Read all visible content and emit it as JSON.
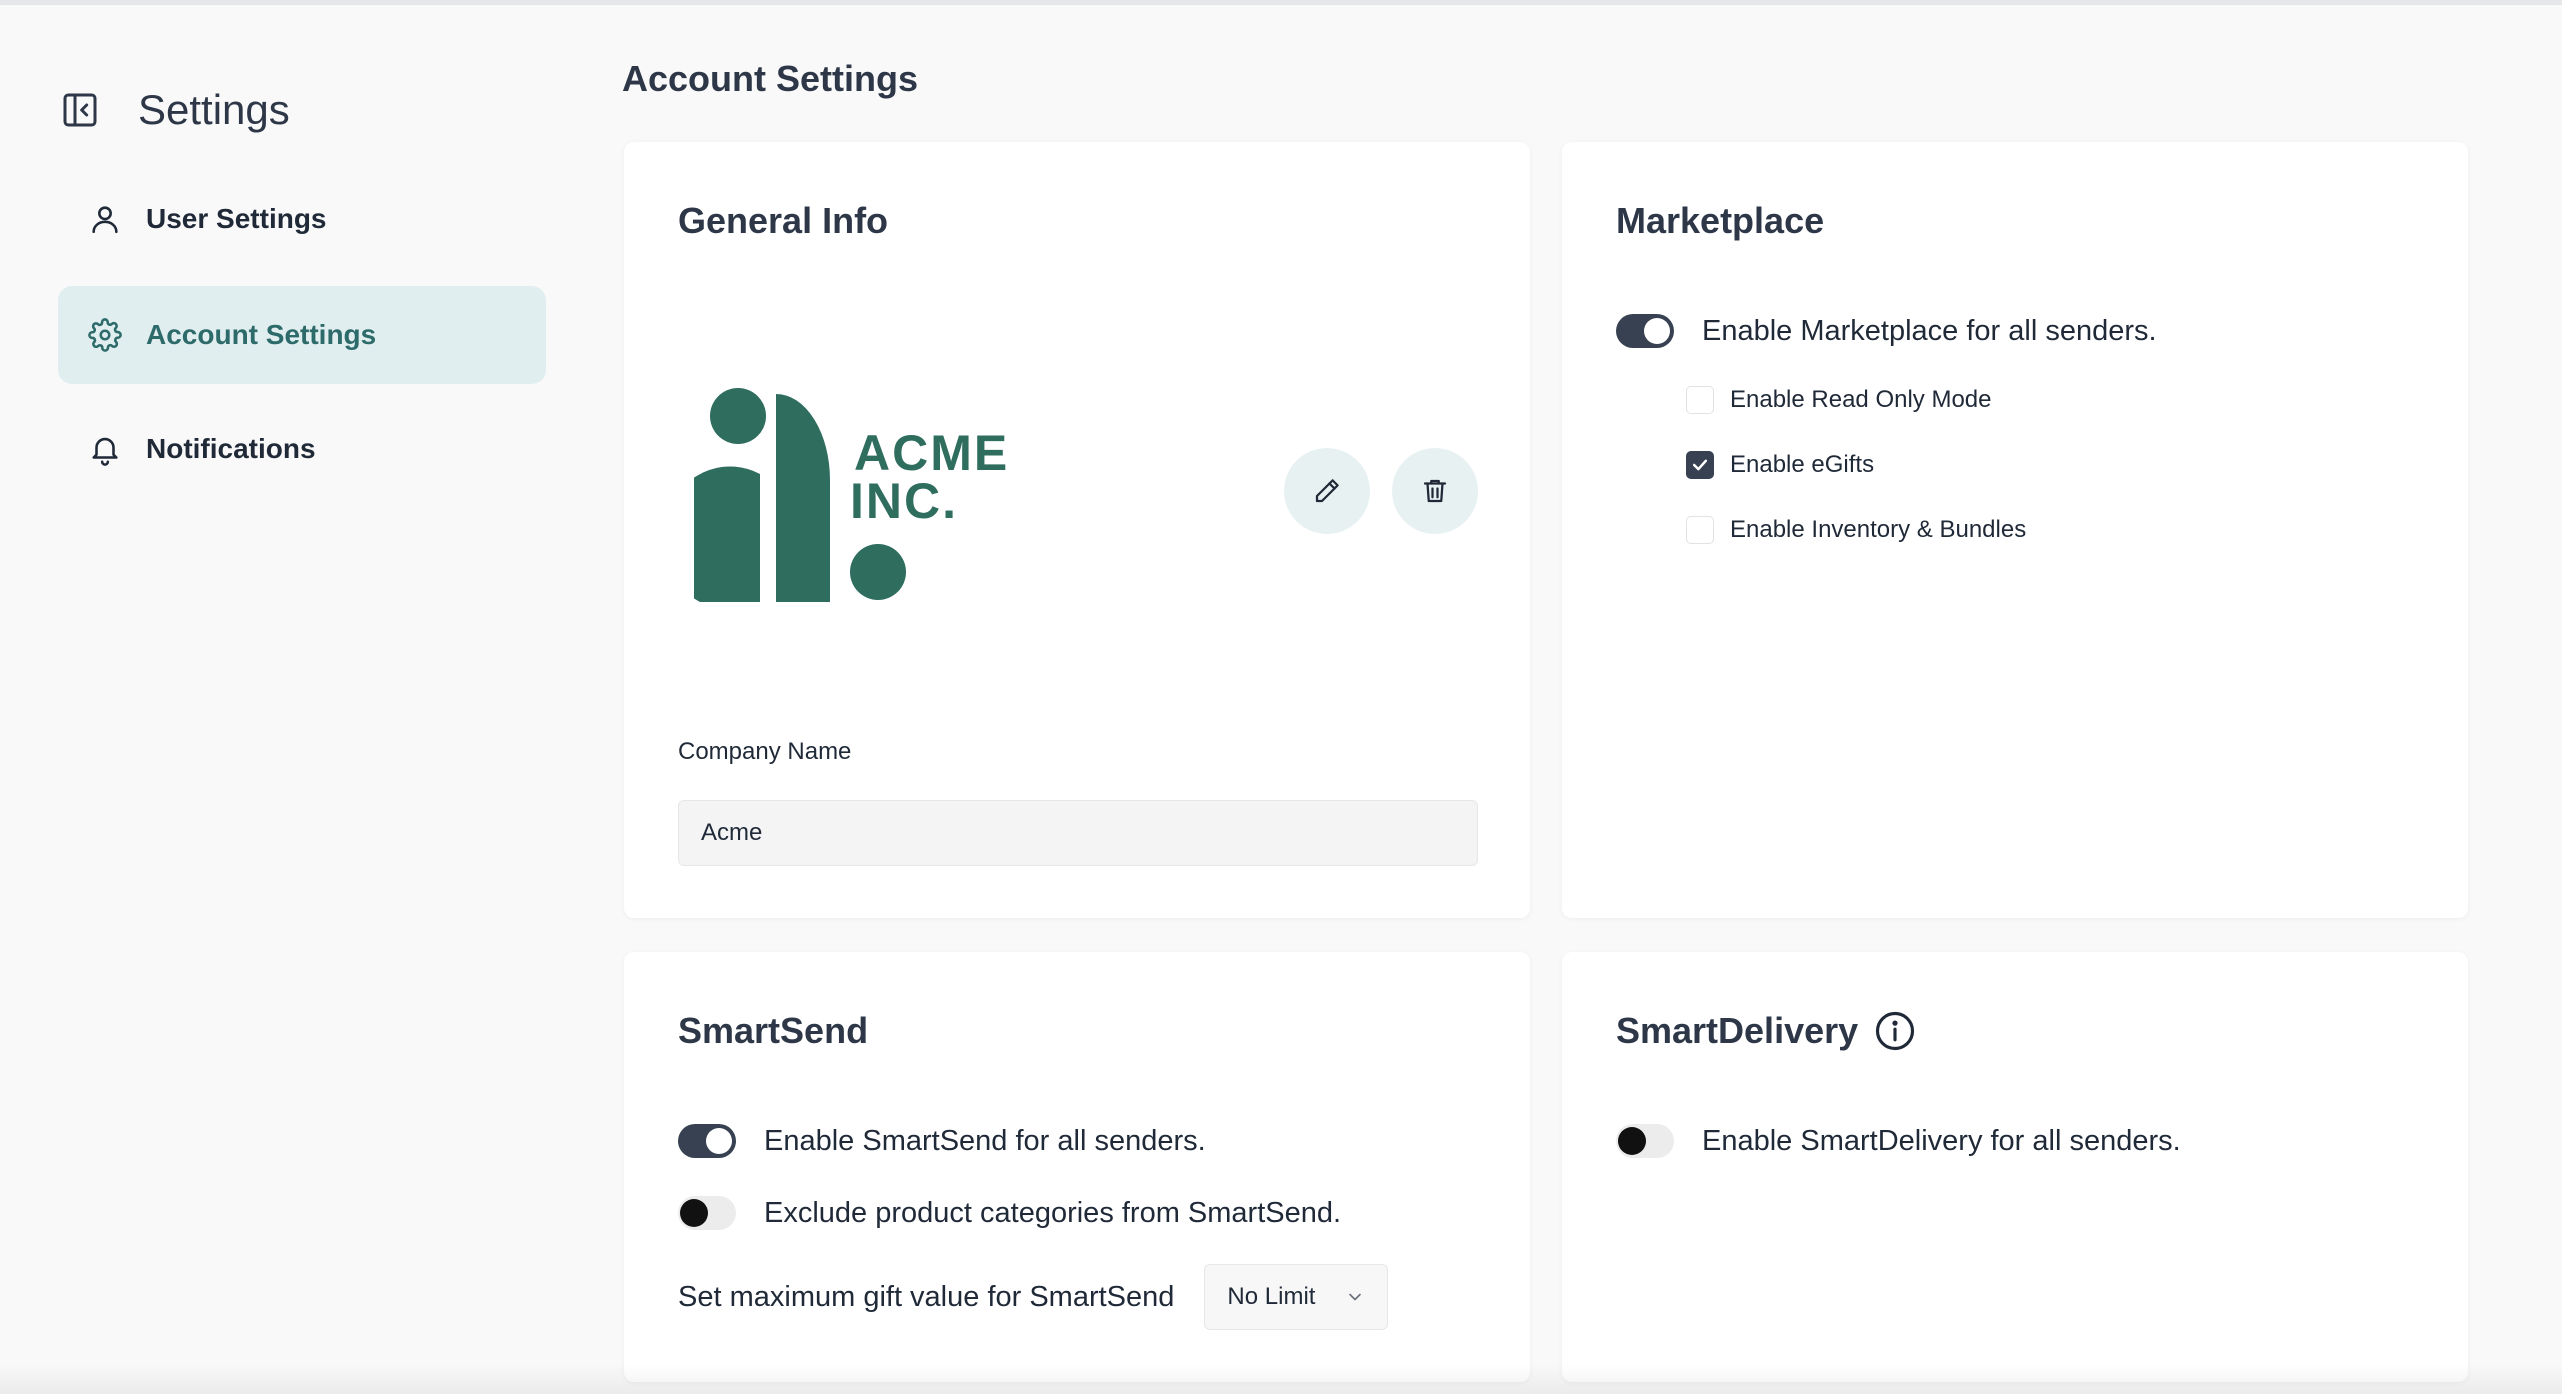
{
  "sidebar": {
    "title": "Settings",
    "items": [
      {
        "label": "User Settings",
        "icon": "user-icon",
        "active": false
      },
      {
        "label": "Account Settings",
        "icon": "gear-icon",
        "active": true
      },
      {
        "label": "Notifications",
        "icon": "bell-icon",
        "active": false
      }
    ]
  },
  "page": {
    "title": "Account Settings"
  },
  "general_info": {
    "title": "General Info",
    "logo_lines": [
      "ACME",
      "INC."
    ],
    "company_name_label": "Company Name",
    "company_name_value": "Acme"
  },
  "marketplace": {
    "title": "Marketplace",
    "toggle_label": "Enable Marketplace for all senders.",
    "toggle_on": true,
    "options": [
      {
        "label": "Enable Read Only Mode",
        "checked": false
      },
      {
        "label": "Enable eGifts",
        "checked": true
      },
      {
        "label": "Enable Inventory & Bundles",
        "checked": false
      }
    ]
  },
  "smartsend": {
    "title": "SmartSend",
    "toggles": [
      {
        "label": "Enable SmartSend for all senders.",
        "on": true
      },
      {
        "label": "Exclude product categories from SmartSend.",
        "on": false
      }
    ],
    "max_value_label": "Set maximum gift value for SmartSend",
    "max_value_selected": "No Limit"
  },
  "smartdelivery": {
    "title": "SmartDelivery",
    "toggle_label": "Enable SmartDelivery for all senders.",
    "toggle_on": false
  },
  "colors": {
    "accent": "#2d6a6a",
    "active_bg": "#e1eef0",
    "logo_green": "#2f6e5f",
    "toggle_on": "#374151"
  }
}
